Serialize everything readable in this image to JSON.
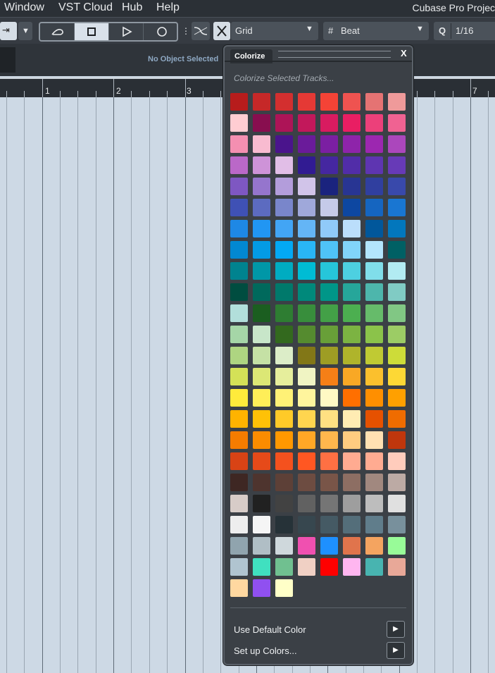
{
  "menubar": {
    "items": [
      "Window",
      "VST Cloud",
      "Hub",
      "Help"
    ],
    "app_title": "Cubase Pro Projec"
  },
  "toolbar": {
    "snap_type": "Grid",
    "grid_type": "Beat",
    "quantize_value": "1/16",
    "quantize_label": "Q"
  },
  "infoline": {
    "status": "No Object Selected"
  },
  "ruler": {
    "labels": [
      "1",
      "2",
      "3",
      "7"
    ]
  },
  "colorize": {
    "title": "Colorize",
    "close": "X",
    "subtitle": "Colorize Selected Tracks...",
    "use_default": "Use Default Color",
    "setup_colors": "Set up Colors...",
    "arrow": "▶",
    "swatches": [
      "#b71c1c",
      "#c62828",
      "#d32f2f",
      "#e53935",
      "#f44336",
      "#ef5350",
      "#e57373",
      "#ef9a9a",
      "#ffcdd2",
      "#880e4f",
      "#ad1457",
      "#c2185b",
      "#d81b60",
      "#e91e63",
      "#ec407a",
      "#f06292",
      "#f48fb1",
      "#f8bbd0",
      "#4a148c",
      "#6a1b9a",
      "#7b1fa2",
      "#8e24aa",
      "#9c27b0",
      "#ab47bc",
      "#ba68c8",
      "#ce93d8",
      "#e1bee7",
      "#311b92",
      "#4527a0",
      "#512da8",
      "#5e35b1",
      "#673ab7",
      "#7e57c2",
      "#9575cd",
      "#b39ddb",
      "#d1c4e9",
      "#1a237e",
      "#283593",
      "#303f9f",
      "#3949ab",
      "#3f51b5",
      "#5c6bc0",
      "#7986cb",
      "#9fa8da",
      "#c5cae9",
      "#0d47a1",
      "#1565c0",
      "#1976d2",
      "#1e88e5",
      "#2196f3",
      "#42a5f5",
      "#64b5f6",
      "#90caf9",
      "#bbdefb",
      "#01579b",
      "#0277bd",
      "#0288d1",
      "#039be5",
      "#03a9f4",
      "#29b6f6",
      "#4fc3f7",
      "#81d4fa",
      "#b3e5fc",
      "#006064",
      "#00838f",
      "#0097a7",
      "#00acc1",
      "#00bcd4",
      "#26c6da",
      "#4dd0e1",
      "#80deea",
      "#b2ebf2",
      "#004d40",
      "#00695c",
      "#00796b",
      "#00897b",
      "#009688",
      "#26a69a",
      "#4db6ac",
      "#80cbc4",
      "#b2dfdb",
      "#1b5e20",
      "#2e7d32",
      "#388e3c",
      "#43a047",
      "#4caf50",
      "#66bb6a",
      "#81c784",
      "#a5d6a7",
      "#c8e6c9",
      "#33691e",
      "#558b2f",
      "#689f38",
      "#7cb342",
      "#8bc34a",
      "#9ccc65",
      "#aed581",
      "#c5e1a5",
      "#dcedc8",
      "#827717",
      "#9e9d24",
      "#afb42b",
      "#c0ca33",
      "#cddc39",
      "#d4e157",
      "#dce775",
      "#e6ee9c",
      "#f0f4c3",
      "#f57f17",
      "#f9a825",
      "#fbc02d",
      "#fdd835",
      "#ffeb3b",
      "#ffee58",
      "#fff176",
      "#fff59d",
      "#fff9c4",
      "#ff6f00",
      "#ff8f00",
      "#ffa000",
      "#ffb300",
      "#ffc107",
      "#ffca28",
      "#ffd54f",
      "#ffe082",
      "#ffecb3",
      "#e65100",
      "#ef6c00",
      "#f57c00",
      "#fb8c00",
      "#ff9800",
      "#ffa726",
      "#ffb74d",
      "#ffcc80",
      "#ffe0b2",
      "#bf360c",
      "#d84315",
      "#e64a19",
      "#f4511e",
      "#ff5722",
      "#ff7043",
      "#ffab91",
      "#ffab91",
      "#ffccbc",
      "#3e2723",
      "#4e342e",
      "#5d4037",
      "#6d4c41",
      "#795548",
      "#8d6e63",
      "#a1887f",
      "#bcaaa4",
      "#d7ccc8",
      "#212121",
      "#424242",
      "#616161",
      "#757575",
      "#9e9e9e",
      "#bdbdbd",
      "#e0e0e0",
      "#eeeeee",
      "#f5f5f5",
      "#263238",
      "#37474f",
      "#455a64",
      "#546e7a",
      "#607d8b",
      "#78909c",
      "#90a4ae",
      "#b0bec5",
      "#cfd8dc",
      "#f050b0",
      "#1e90ff",
      "#e0744c",
      "#f4a460",
      "#98fb98",
      "#b0c4d0",
      "#40e0c0",
      "#70c090",
      "#f0d0c4",
      "#ff0000",
      "#ffb6f0",
      "#48b4b0",
      "#e8a898",
      "#ffd8a0",
      "#9050f0",
      "#ffffc8"
    ]
  }
}
